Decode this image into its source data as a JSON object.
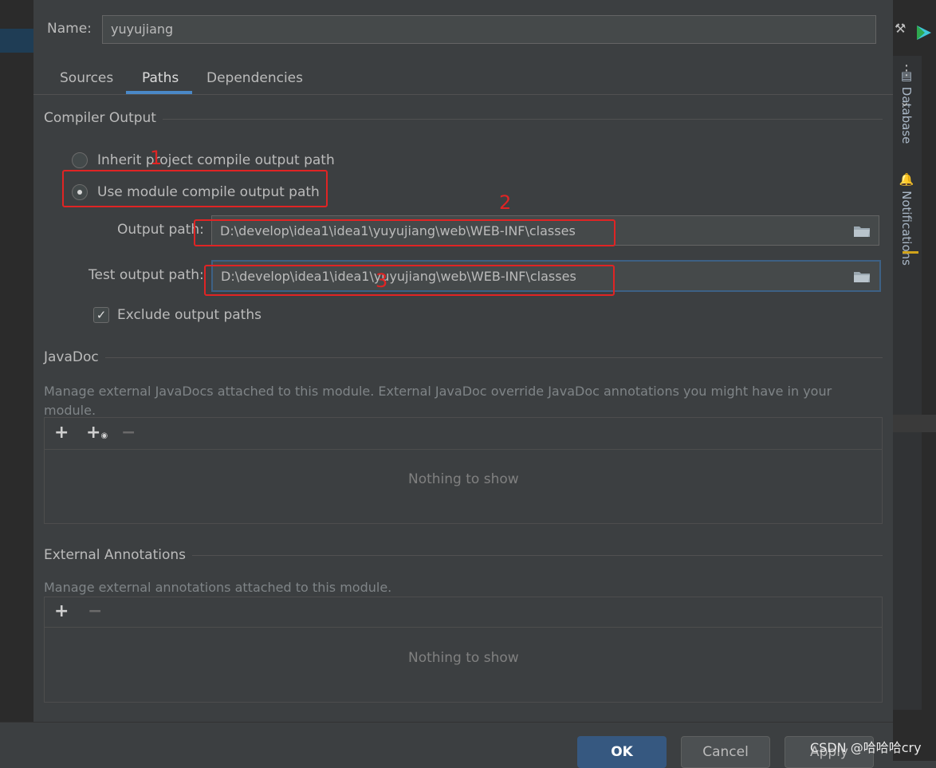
{
  "dialog": {
    "name_label": "Name:",
    "name_value": "yuyujiang",
    "tabs": [
      {
        "label": "Sources",
        "active": false
      },
      {
        "label": "Paths",
        "active": true
      },
      {
        "label": "Dependencies",
        "active": false
      }
    ],
    "compiler_output": {
      "title": "Compiler Output",
      "inherit_label": "Inherit project compile output path",
      "use_module_label": "Use module compile output path",
      "selected": "use_module",
      "output_path_label": "Output path:",
      "output_path_value": "D:\\develop\\idea1\\idea1\\yuyujiang\\web\\WEB-INF\\classes",
      "test_output_path_label": "Test output path:",
      "test_output_path_value": "D:\\develop\\idea1\\idea1\\yuyujiang\\web\\WEB-INF\\classes",
      "exclude_label": "Exclude output paths",
      "exclude_checked": true
    },
    "javadoc": {
      "title": "JavaDoc",
      "description": "Manage external JavaDocs attached to this module. External JavaDoc override JavaDoc annotations you might have in your module.",
      "empty_text": "Nothing to show"
    },
    "external_annotations": {
      "title": "External Annotations",
      "description": "Manage external annotations attached to this module.",
      "empty_text": "Nothing to show"
    },
    "buttons": {
      "ok": "OK",
      "cancel": "Cancel",
      "apply": "Apply"
    }
  },
  "annotations": {
    "n1": "1",
    "n2": "2",
    "n3": "3"
  },
  "side_panels": {
    "database": "Database",
    "notifications": "Notifications"
  },
  "watermark": "CSDN @哈哈哈cry",
  "colors": {
    "accent_tab": "#4a88c7",
    "annotation_red": "#e02424",
    "ok_button": "#365880"
  }
}
